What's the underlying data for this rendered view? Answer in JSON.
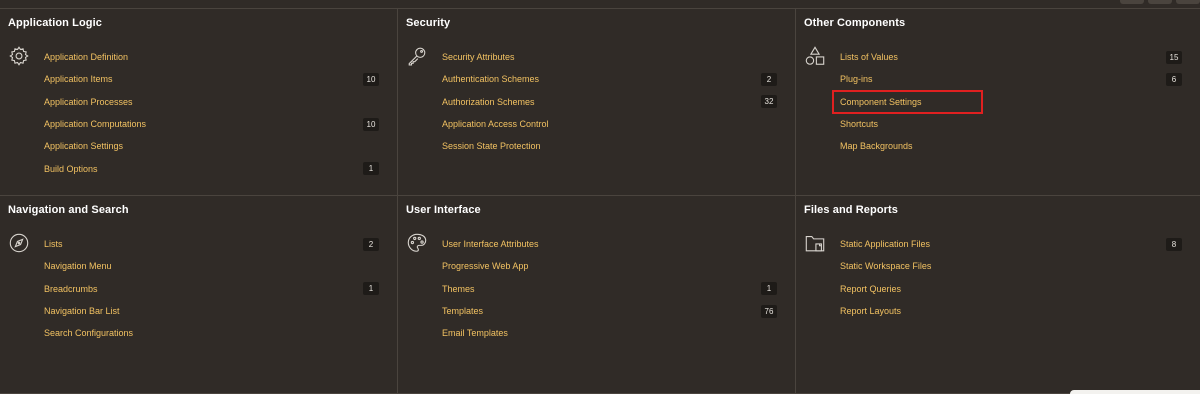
{
  "panels": [
    {
      "title": "Application Logic",
      "icon": "gear-icon",
      "items": [
        {
          "label": "Application Definition",
          "count": ""
        },
        {
          "label": "Application Items",
          "count": "10"
        },
        {
          "label": "Application Processes",
          "count": ""
        },
        {
          "label": "Application Computations",
          "count": "10"
        },
        {
          "label": "Application Settings",
          "count": ""
        },
        {
          "label": "Build Options",
          "count": "1"
        }
      ]
    },
    {
      "title": "Security",
      "icon": "key-icon",
      "items": [
        {
          "label": "Security Attributes",
          "count": ""
        },
        {
          "label": "Authentication Schemes",
          "count": "2"
        },
        {
          "label": "Authorization Schemes",
          "count": "32"
        },
        {
          "label": "Application Access Control",
          "count": ""
        },
        {
          "label": "Session State Protection",
          "count": ""
        }
      ]
    },
    {
      "title": "Other Components",
      "icon": "shapes-icon",
      "items": [
        {
          "label": "Lists of Values",
          "count": "15"
        },
        {
          "label": "Plug-ins",
          "count": "6"
        },
        {
          "label": "Component Settings",
          "count": ""
        },
        {
          "label": "Shortcuts",
          "count": ""
        },
        {
          "label": "Map Backgrounds",
          "count": ""
        }
      ]
    },
    {
      "title": "Navigation and Search",
      "icon": "compass-icon",
      "items": [
        {
          "label": "Lists",
          "count": "2"
        },
        {
          "label": "Navigation Menu",
          "count": ""
        },
        {
          "label": "Breadcrumbs",
          "count": "1"
        },
        {
          "label": "Navigation Bar List",
          "count": ""
        },
        {
          "label": "Search Configurations",
          "count": ""
        }
      ]
    },
    {
      "title": "User Interface",
      "icon": "palette-icon",
      "items": [
        {
          "label": "User Interface Attributes",
          "count": ""
        },
        {
          "label": "Progressive Web App",
          "count": ""
        },
        {
          "label": "Themes",
          "count": "1"
        },
        {
          "label": "Templates",
          "count": "76"
        },
        {
          "label": "Email Templates",
          "count": ""
        }
      ]
    },
    {
      "title": "Files and Reports",
      "icon": "folder-icon",
      "items": [
        {
          "label": "Static Application Files",
          "count": "8"
        },
        {
          "label": "Static Workspace Files",
          "count": ""
        },
        {
          "label": "Report Queries",
          "count": ""
        },
        {
          "label": "Report Layouts",
          "count": ""
        }
      ]
    }
  ],
  "colors": {
    "background": "#302b27",
    "link": "#f2c262",
    "divider": "#4a443e",
    "badge_bg": "#1e1b18",
    "highlight": "#e02020"
  }
}
